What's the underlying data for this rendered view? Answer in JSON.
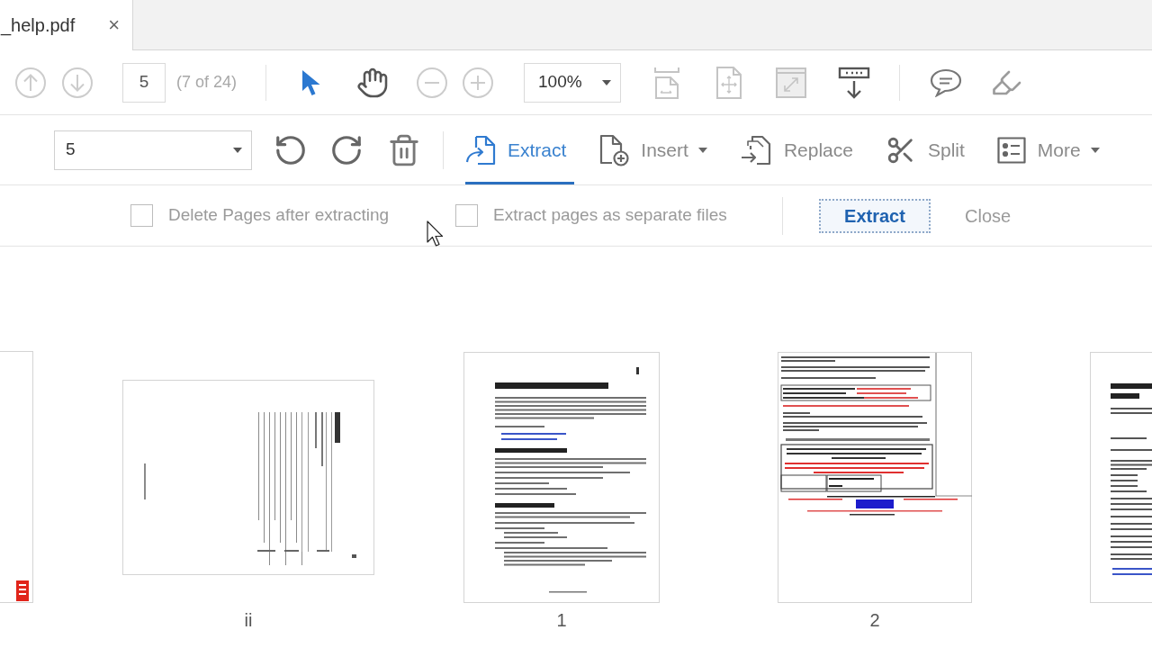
{
  "document_tab": {
    "title": "_help.pdf",
    "close": "×"
  },
  "toolbar": {
    "page_nav": [
      {
        "kind": "previous",
        "disabled": true
      },
      {
        "kind": "next",
        "disabled": true
      }
    ],
    "page_number": "5",
    "page_position": "(7 of 24)",
    "tools": [
      {
        "kind": "select",
        "selected": true
      },
      {
        "kind": "hand",
        "selected": false
      }
    ],
    "zoom_buttons": [
      {
        "kind": "zoom-out",
        "disabled": true
      },
      {
        "kind": "zoom-in",
        "disabled": true
      }
    ],
    "zoom": "100%",
    "view_tools": [
      {
        "kind": "fit-width",
        "disabled": true
      },
      {
        "kind": "fit-page",
        "disabled": true
      },
      {
        "kind": "full-screen",
        "disabled": true
      },
      {
        "kind": "scroll",
        "disabled": false
      }
    ]
  },
  "organize_bar": {
    "page_range": "5",
    "tabs": [
      {
        "kind": "extract",
        "label": "Extract",
        "selected": true,
        "menu": false
      },
      {
        "kind": "insert",
        "label": "Insert",
        "selected": false,
        "menu": true
      },
      {
        "kind": "replace",
        "label": "Replace",
        "selected": false,
        "menu": false
      },
      {
        "kind": "split",
        "label": "Split",
        "selected": false,
        "menu": false
      },
      {
        "kind": "more",
        "label": "More",
        "selected": false,
        "menu": true
      }
    ]
  },
  "extract_bar": {
    "options": [
      {
        "label": "Delete Pages after extracting",
        "checked": false
      },
      {
        "label": "Extract pages as separate files",
        "checked": false
      }
    ],
    "buttons": [
      {
        "label": "Extract",
        "focused": true
      },
      {
        "label": "Close",
        "focused": false
      }
    ]
  },
  "pages": [
    {
      "kind": "cover"
    },
    {
      "kind": "contents",
      "label": "ii"
    },
    {
      "kind": "chapter",
      "label": "1"
    },
    {
      "kind": "form",
      "label": "2"
    },
    {
      "kind": "chapter-title"
    }
  ]
}
